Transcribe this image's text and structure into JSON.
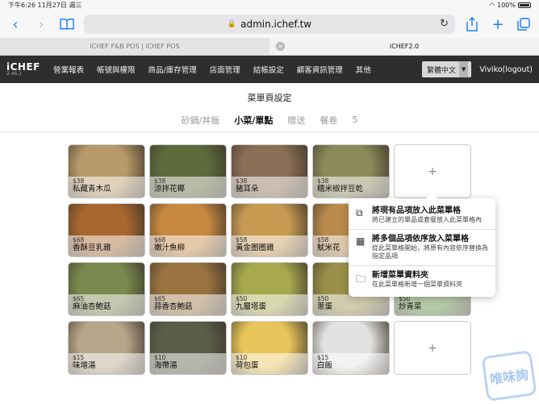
{
  "status": {
    "time": "下午6:26",
    "date": "11月27日 週三",
    "battery": "100%"
  },
  "safari": {
    "url": "admin.ichef.tw",
    "lock": "🔒",
    "reload": "↻"
  },
  "browser_tabs": [
    {
      "label": "iCHEF F&B POS | iCHEF POS",
      "active": false
    },
    {
      "label": "iCHEF2.0",
      "active": true
    }
  ],
  "app": {
    "logo": "iCHEF",
    "version": "2.46.1",
    "menu": [
      "營業報表",
      "帳號與權限",
      "商品/庫存管理",
      "店面管理",
      "結帳設定",
      "顧客資訊管理",
      "其他"
    ],
    "language": "繁體中文",
    "user": "Viviko(logout)"
  },
  "page": {
    "title": "菜單頁設定",
    "tabs": [
      {
        "label": "砂鍋/丼飯",
        "active": false
      },
      {
        "label": "小菜/單點",
        "active": true
      },
      {
        "label": "贈送",
        "active": false
      },
      {
        "label": "餐卷",
        "active": false
      },
      {
        "label": "5",
        "active": false
      }
    ]
  },
  "items": [
    {
      "price": "$38",
      "name": "私藏青木瓜",
      "color": "#b89a6a"
    },
    {
      "price": "$38",
      "name": "涼拌花椰",
      "color": "#5e6c3c"
    },
    {
      "price": "$38",
      "name": "豬耳朵",
      "color": "#8a6e55"
    },
    {
      "price": "$38",
      "name": "糯米椒拌豆乾",
      "color": "#8c8a5a"
    },
    {
      "empty": true
    },
    {
      "price": "$68",
      "name": "香酥豆乳雞",
      "color": "#a8672f"
    },
    {
      "price": "$68",
      "name": "嫩汁魚柳",
      "color": "#c88a40"
    },
    {
      "price": "$58",
      "name": "黃金圈圈雞",
      "color": "#c79a52"
    },
    {
      "price": "$58",
      "name": "魷米花",
      "color": "#b98a4c"
    },
    {
      "hidden": true
    },
    {
      "price": "$65",
      "name": "麻油杏鮑菇",
      "color": "#7a8a4e"
    },
    {
      "price": "$65",
      "name": "蒜香杏鮑菇",
      "color": "#9a7440"
    },
    {
      "price": "$50",
      "name": "九層塔蛋",
      "color": "#a8a94e"
    },
    {
      "price": "$50",
      "name": "蔥蛋",
      "color": "#9a8f4a"
    },
    {
      "price": "$50",
      "name": "炒青菜",
      "color": "#5d8a3c"
    },
    {
      "price": "$15",
      "name": "味增湯",
      "color": "#b7a68a"
    },
    {
      "price": "$10",
      "name": "海帶湯",
      "color": "#5b5f4a"
    },
    {
      "price": "$10",
      "name": "荷包蛋",
      "color": "#e8c55a"
    },
    {
      "price": "$15",
      "name": "白飯",
      "color": "#e2e2e0"
    },
    {
      "empty": true
    }
  ],
  "popover": [
    {
      "icon": "add-existing-icon",
      "glyph": "⧉",
      "title": "將現有品項放入此菜單格",
      "desc": "將已建立的單品或套餐放入此菜單格內"
    },
    {
      "icon": "grid-icon",
      "glyph": "▦",
      "title": "將多個品項依序放入菜單格",
      "desc": "從此菜單格開始，將原有內容依序替換為指定品項"
    },
    {
      "icon": "folder-icon",
      "glyph": "🗀",
      "title": "新增菜單資料夾",
      "desc": "在此菜單格新增一個菜單資料夾"
    }
  ],
  "add_symbol": "+",
  "watermark": "唯味詢"
}
